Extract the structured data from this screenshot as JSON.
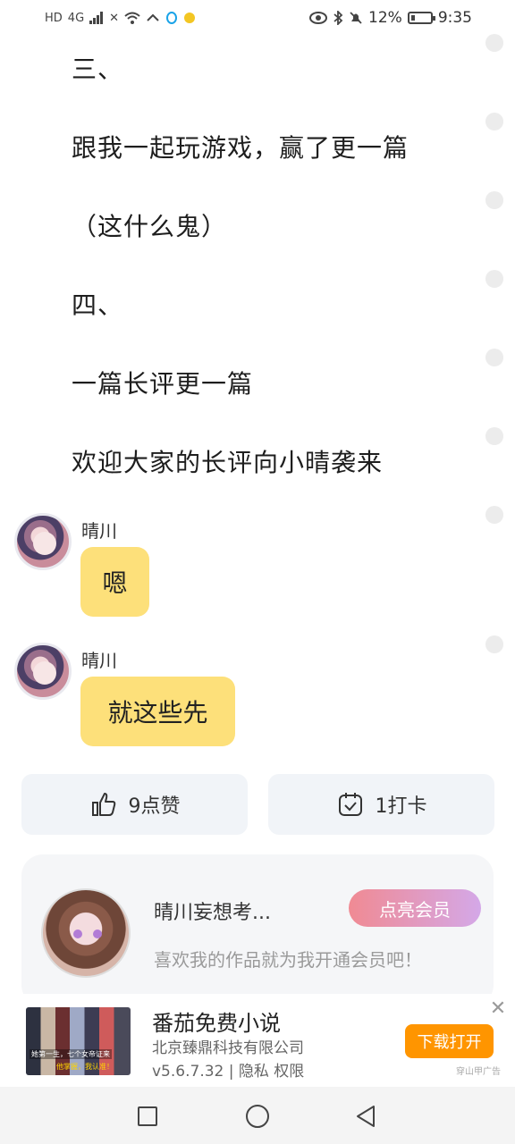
{
  "status_bar": {
    "left_glyphs": [
      "HD",
      "4G",
      "✕"
    ],
    "battery_percent": "12%",
    "time": "9:35"
  },
  "story_lines": [
    "三、",
    "跟我一起玩游戏，赢了更一篇",
    "（这什么鬼）",
    "四、",
    "一篇长评更一篇",
    "欢迎大家的长评向小晴袭来"
  ],
  "chat": [
    {
      "name": "晴川",
      "message": "嗯"
    },
    {
      "name": "晴川",
      "message": "就这些先"
    }
  ],
  "actions": {
    "like_label": "9点赞",
    "checkin_label": "1打卡"
  },
  "author": {
    "name": "晴川妄想考...",
    "member_button": "点亮会员",
    "slogan": "喜欢我的作品就为我开通会员吧！"
  },
  "ad": {
    "title": "番茄免费小说",
    "company": "北京臻鼎科技有限公司",
    "meta": "v5.6.7.32 | 隐私 权限",
    "download_button": "下载打开",
    "source": "穿山甲广告",
    "thumb_caption_1": "她第一生，七个女帝证来",
    "thumb_caption_2": "他掌握，我认准！"
  },
  "colors": {
    "bubble": "#fde07a",
    "download": "#ff9500",
    "member_gradient_start": "#f08a93",
    "member_gradient_end": "#d4a8e8"
  }
}
